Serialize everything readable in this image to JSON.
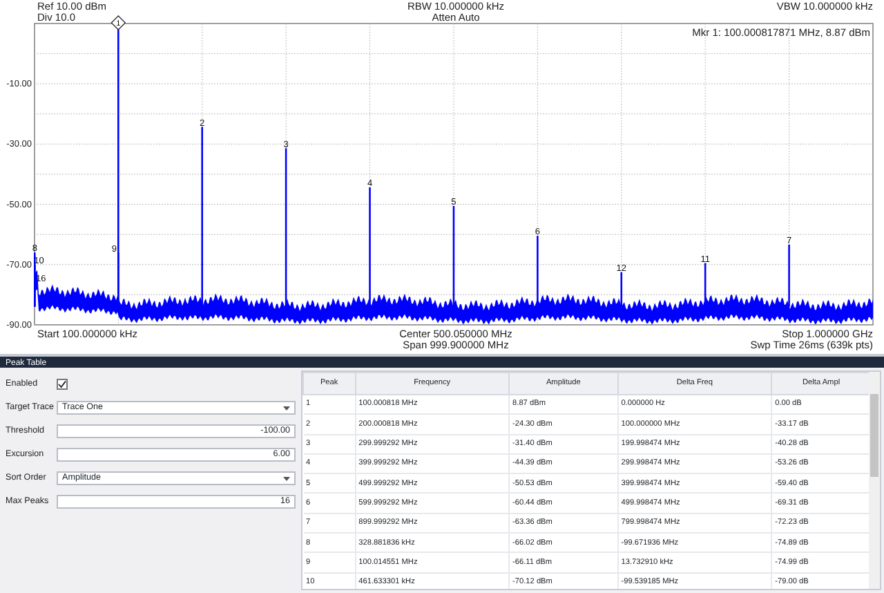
{
  "plot": {
    "header_left": [
      "Ref 10.00 dBm",
      "Div 10.0"
    ],
    "header_center": [
      "RBW 10.000000 kHz",
      "Atten Auto"
    ],
    "header_right": [
      "VBW 10.000000 kHz"
    ],
    "marker_readout": "Mkr 1: 100.000817871 MHz, 8.87 dBm",
    "footer_left": [
      "Start 100.000000 kHz"
    ],
    "footer_center": [
      "Center 500.050000 MHz",
      "Span 999.900000 MHz"
    ],
    "footer_right": [
      "Stop 1.000000 GHz",
      "Swp Time 26ms (639k pts)"
    ],
    "y_labels": [
      "-10.00",
      "-30.00",
      "-50.00",
      "-70.00",
      "-90.00"
    ],
    "markers": [
      {
        "label": "1",
        "kind": "diamond"
      },
      {
        "label": "2",
        "kind": "plain"
      },
      {
        "label": "3",
        "kind": "plain"
      },
      {
        "label": "4",
        "kind": "plain"
      },
      {
        "label": "5",
        "kind": "plain"
      },
      {
        "label": "6",
        "kind": "plain"
      },
      {
        "label": "7",
        "kind": "plain"
      },
      {
        "label": "8",
        "kind": "plain"
      },
      {
        "label": "9",
        "kind": "plain"
      },
      {
        "label": "10",
        "kind": "plain"
      },
      {
        "label": "11",
        "kind": "plain"
      },
      {
        "label": "12",
        "kind": "plain"
      },
      {
        "label": "16",
        "kind": "plain"
      }
    ]
  },
  "panel_title": "Peak Table",
  "settings": [
    {
      "label": "Enabled",
      "kind": "checkbox",
      "checked": true
    },
    {
      "label": "Target Trace",
      "kind": "select",
      "value": "Trace One"
    },
    {
      "label": "Threshold",
      "kind": "number",
      "value": "-100.00"
    },
    {
      "label": "Excursion",
      "kind": "number",
      "value": "6.00"
    },
    {
      "label": "Sort Order",
      "kind": "select",
      "value": "Amplitude"
    },
    {
      "label": "Max Peaks",
      "kind": "number",
      "value": "16"
    }
  ],
  "table": {
    "columns": [
      "Peak",
      "Frequency",
      "Amplitude",
      "Delta Freq",
      "Delta Ampl"
    ],
    "rows": [
      [
        "1",
        "100.000818 MHz",
        "8.87 dBm",
        "0.000000 Hz",
        "0.00 dB"
      ],
      [
        "2",
        "200.000818 MHz",
        "-24.30 dBm",
        "100.000000 MHz",
        "-33.17 dB"
      ],
      [
        "3",
        "299.999292 MHz",
        "-31.40 dBm",
        "199.998474 MHz",
        "-40.28 dB"
      ],
      [
        "4",
        "399.999292 MHz",
        "-44.39 dBm",
        "299.998474 MHz",
        "-53.26 dB"
      ],
      [
        "5",
        "499.999292 MHz",
        "-50.53 dBm",
        "399.998474 MHz",
        "-59.40 dB"
      ],
      [
        "6",
        "599.999292 MHz",
        "-60.44 dBm",
        "499.998474 MHz",
        "-69.31 dB"
      ],
      [
        "7",
        "899.999292 MHz",
        "-63.36 dBm",
        "799.998474 MHz",
        "-72.23 dB"
      ],
      [
        "8",
        "328.881836 kHz",
        "-66.02 dBm",
        "-99.671936 MHz",
        "-74.89 dB"
      ],
      [
        "9",
        "100.014551 MHz",
        "-66.11 dBm",
        "13.732910 kHz",
        "-74.99 dB"
      ],
      [
        "10",
        "461.633301 kHz",
        "-70.12 dBm",
        "-99.539185 MHz",
        "-79.00 dB"
      ]
    ]
  }
}
